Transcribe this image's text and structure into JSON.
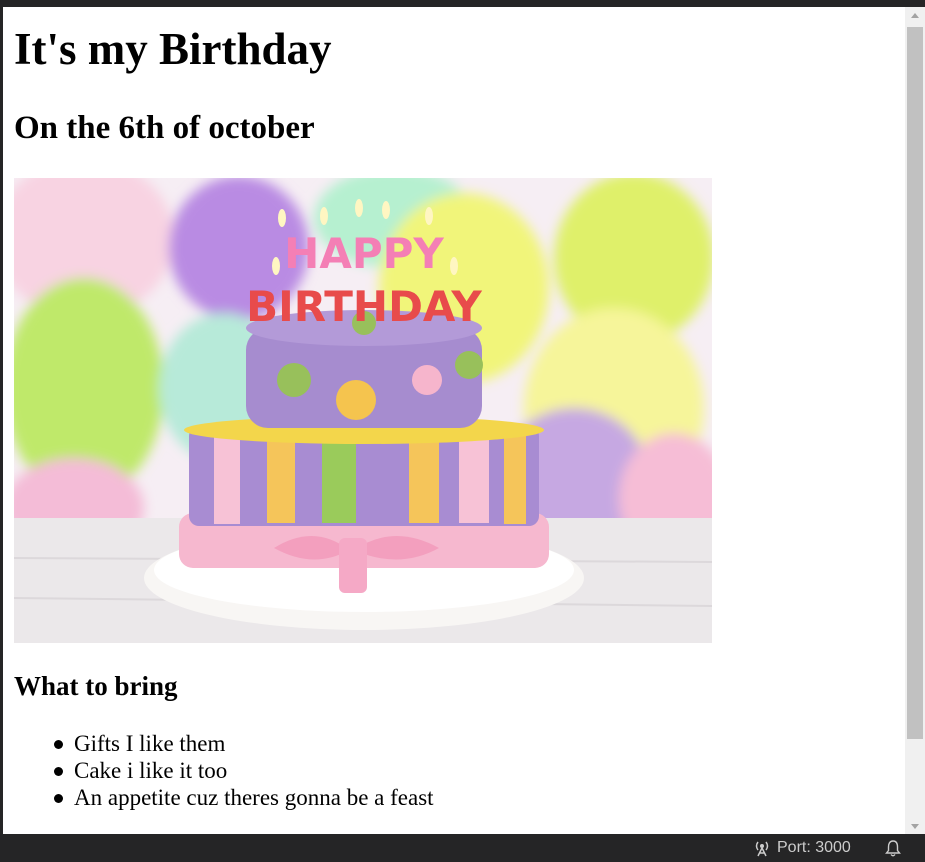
{
  "page": {
    "title": "It's my Birthday",
    "subtitle": "On the 6th of october",
    "image": {
      "name": "birthday-cake-photo",
      "caption_letters": "HAPPY BIRTHDAY"
    },
    "bring_heading": "What to bring",
    "bring_items": [
      "Gifts I like them",
      "Cake i like it too",
      "An appetite cuz theres gonna be a feast"
    ]
  },
  "status_bar": {
    "port_label": "Port: 3000",
    "port_icon": "broadcast-icon",
    "bell_icon": "bell-icon"
  },
  "colors": {
    "chrome": "#252526",
    "status_text": "#cccccc",
    "cake_purple": "#a88cd2",
    "cake_green": "#9acb5b",
    "cake_yellow": "#f5c55a",
    "cake_pink": "#f7b7cd"
  }
}
